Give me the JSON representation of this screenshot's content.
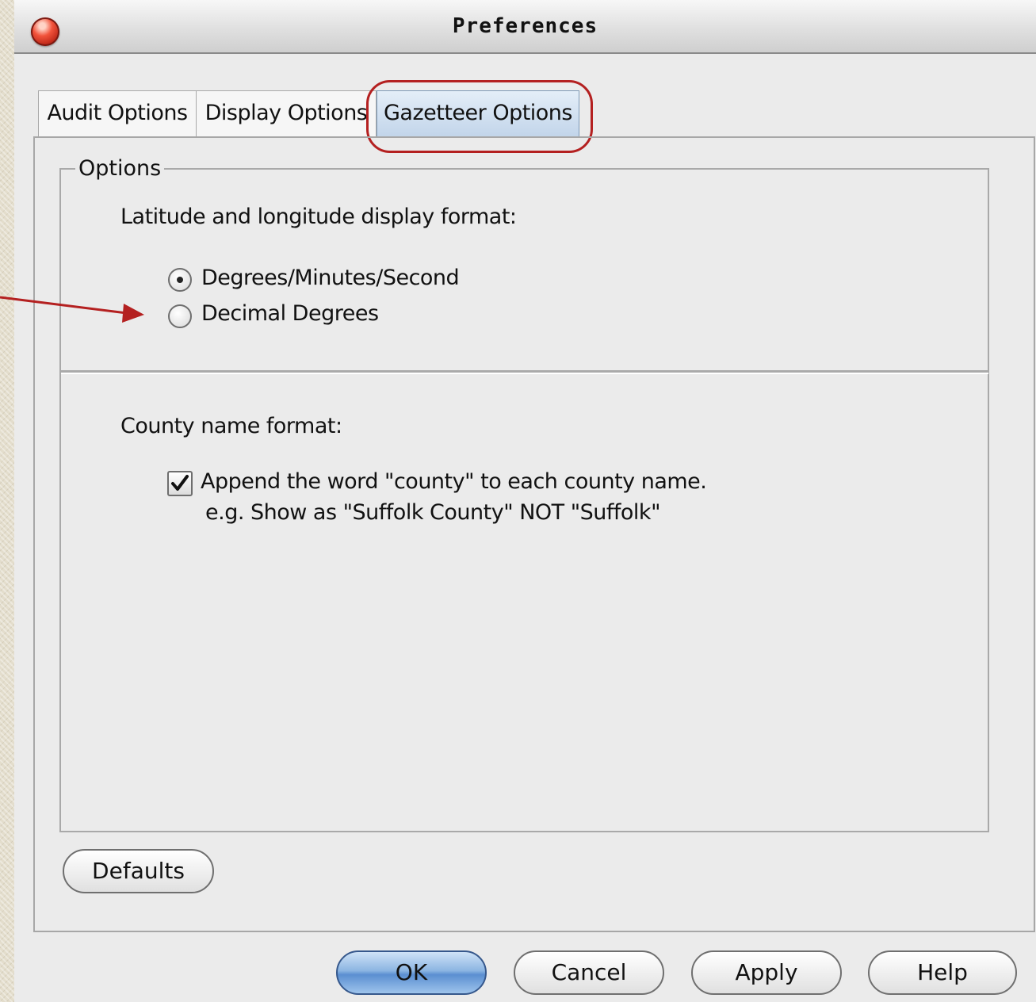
{
  "window": {
    "title": "Preferences"
  },
  "tabs": [
    {
      "label": "Audit Options",
      "selected": false
    },
    {
      "label": "Display Options",
      "selected": false
    },
    {
      "label": "Gazetteer Options",
      "selected": true
    }
  ],
  "options_group": {
    "legend": "Options",
    "lat_lon": {
      "label": "Latitude and longitude display format:",
      "choices": [
        {
          "label": "Degrees/Minutes/Second",
          "checked": true
        },
        {
          "label": "Decimal Degrees",
          "checked": false
        }
      ]
    },
    "county": {
      "label": "County name format:",
      "append_county": {
        "label": "Append the word \"county\" to each county name.",
        "example": "e.g. Show as \"Suffolk County\" NOT \"Suffolk\"",
        "checked": true
      }
    }
  },
  "buttons": {
    "defaults": "Defaults",
    "ok": "OK",
    "cancel": "Cancel",
    "apply": "Apply",
    "help": "Help"
  },
  "annotation_color": "#b42020",
  "icons": {
    "close": "close-icon",
    "radio_selected": "radio-selected-icon",
    "radio_unselected": "radio-unselected-icon",
    "check": "checkmark-icon",
    "arrow": "arrow-right-icon"
  }
}
